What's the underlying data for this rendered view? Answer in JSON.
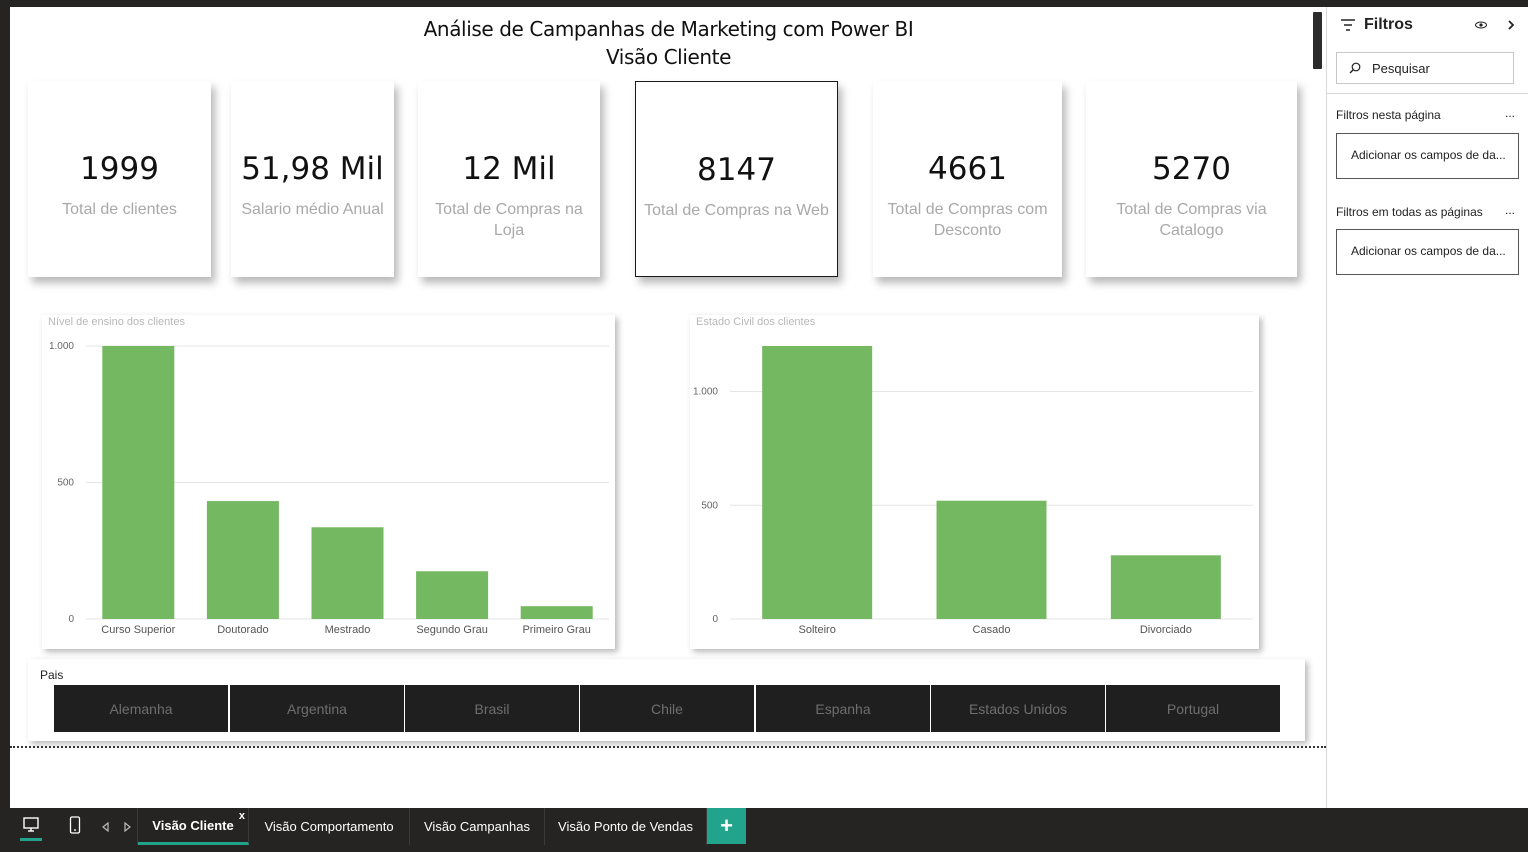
{
  "report": {
    "title_line1": "Análise de Campanhas de Marketing com Power BI",
    "title_line2": "Visão Cliente"
  },
  "cards": [
    {
      "value": "1999",
      "label": "Total de clientes"
    },
    {
      "value": "51,98 Mil",
      "label": "Salario médio Anual"
    },
    {
      "value": "12 Mil",
      "label": "Total de Compras na Loja"
    },
    {
      "value": "8147",
      "label": "Total de Compras na Web"
    },
    {
      "value": "4661",
      "label": "Total de Compras com Desconto"
    },
    {
      "value": "5270",
      "label": "Total de Compras via Catalogo"
    }
  ],
  "chart_data": [
    {
      "type": "bar",
      "title": "Nível de ensino dos clientes",
      "categories": [
        "Curso Superior",
        "Doutorado",
        "Mestrado",
        "Segundo Grau",
        "Primeiro Grau"
      ],
      "values": [
        1000,
        432,
        336,
        175,
        47
      ],
      "yticks": [
        0,
        500,
        1000
      ],
      "ytick_labels": [
        "0",
        "500",
        "1.000"
      ],
      "ylim": [
        0,
        1000
      ],
      "color": "#74b862",
      "grid": true
    },
    {
      "type": "bar",
      "title": "Estado Civil dos clientes",
      "categories": [
        "Solteiro",
        "Casado",
        "Divorciado"
      ],
      "values": [
        1200,
        520,
        280
      ],
      "yticks": [
        0,
        500,
        1000
      ],
      "ytick_labels": [
        "0",
        "500",
        "1.000"
      ],
      "ylim": [
        0,
        1200
      ],
      "color": "#74b862",
      "grid": true
    }
  ],
  "slicer": {
    "title": "Pais",
    "options": [
      "Alemanha",
      "Argentina",
      "Brasil",
      "Chile",
      "Espanha",
      "Estados Unidos",
      "Portugal"
    ]
  },
  "filters": {
    "title": "Filtros",
    "search_placeholder": "Pesquisar",
    "page_section": "Filtros nesta página",
    "all_section": "Filtros em todas as páginas",
    "more": "...",
    "add_fields": "Adicionar os campos de da...",
    "icons": [
      "filter-icon",
      "eye-icon",
      "chevron-right-icon",
      "search-icon"
    ]
  },
  "tabs": {
    "items": [
      "Visão Cliente",
      "Visão Comportamento",
      "Visão Campanhas",
      "Visão Ponto de Vendas"
    ],
    "active_index": 0,
    "close": "x",
    "add": "+",
    "icons": [
      "desktop-icon",
      "phone-icon",
      "prev-icon",
      "next-icon"
    ]
  },
  "colors": {
    "accent": "#21a38c",
    "bar": "#74b862",
    "slicer_bg": "#1f1f1f",
    "chrome": "#252423"
  }
}
